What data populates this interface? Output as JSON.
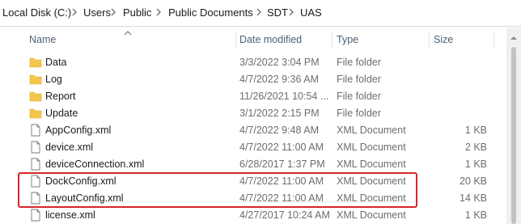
{
  "breadcrumb": [
    "Local Disk (C:)",
    "Users",
    "Public",
    "Public Documents",
    "SDT",
    "UAS"
  ],
  "columns": {
    "name": "Name",
    "date": "Date modified",
    "type": "Type",
    "size": "Size"
  },
  "rows": [
    {
      "name": "Data",
      "date": "3/3/2022 3:04 PM",
      "type": "File folder",
      "size": "",
      "kind": "folder"
    },
    {
      "name": "Log",
      "date": "4/7/2022 9:36 AM",
      "type": "File folder",
      "size": "",
      "kind": "folder"
    },
    {
      "name": "Report",
      "date": "11/26/2021 10:54 ...",
      "type": "File folder",
      "size": "",
      "kind": "folder"
    },
    {
      "name": "Update",
      "date": "3/1/2022 2:15 PM",
      "type": "File folder",
      "size": "",
      "kind": "folder"
    },
    {
      "name": "AppConfig.xml",
      "date": "4/7/2022 9:48 AM",
      "type": "XML Document",
      "size": "1 KB",
      "kind": "file"
    },
    {
      "name": "device.xml",
      "date": "4/7/2022 11:00 AM",
      "type": "XML Document",
      "size": "2 KB",
      "kind": "file"
    },
    {
      "name": "deviceConnection.xml",
      "date": "6/28/2017 1:37 PM",
      "type": "XML Document",
      "size": "1 KB",
      "kind": "file"
    },
    {
      "name": "DockConfig.xml",
      "date": "4/7/2022 11:00 AM",
      "type": "XML Document",
      "size": "20 KB",
      "kind": "file"
    },
    {
      "name": "LayoutConfig.xml",
      "date": "4/7/2022 11:00 AM",
      "type": "XML Document",
      "size": "14 KB",
      "kind": "file"
    },
    {
      "name": "license.xml",
      "date": "4/27/2017 10:24 AM",
      "type": "XML Document",
      "size": "1 KB",
      "kind": "file"
    }
  ],
  "colors": {
    "folder": "#f4c74a",
    "highlight": "#d7262b",
    "header_text": "#4c607a"
  }
}
